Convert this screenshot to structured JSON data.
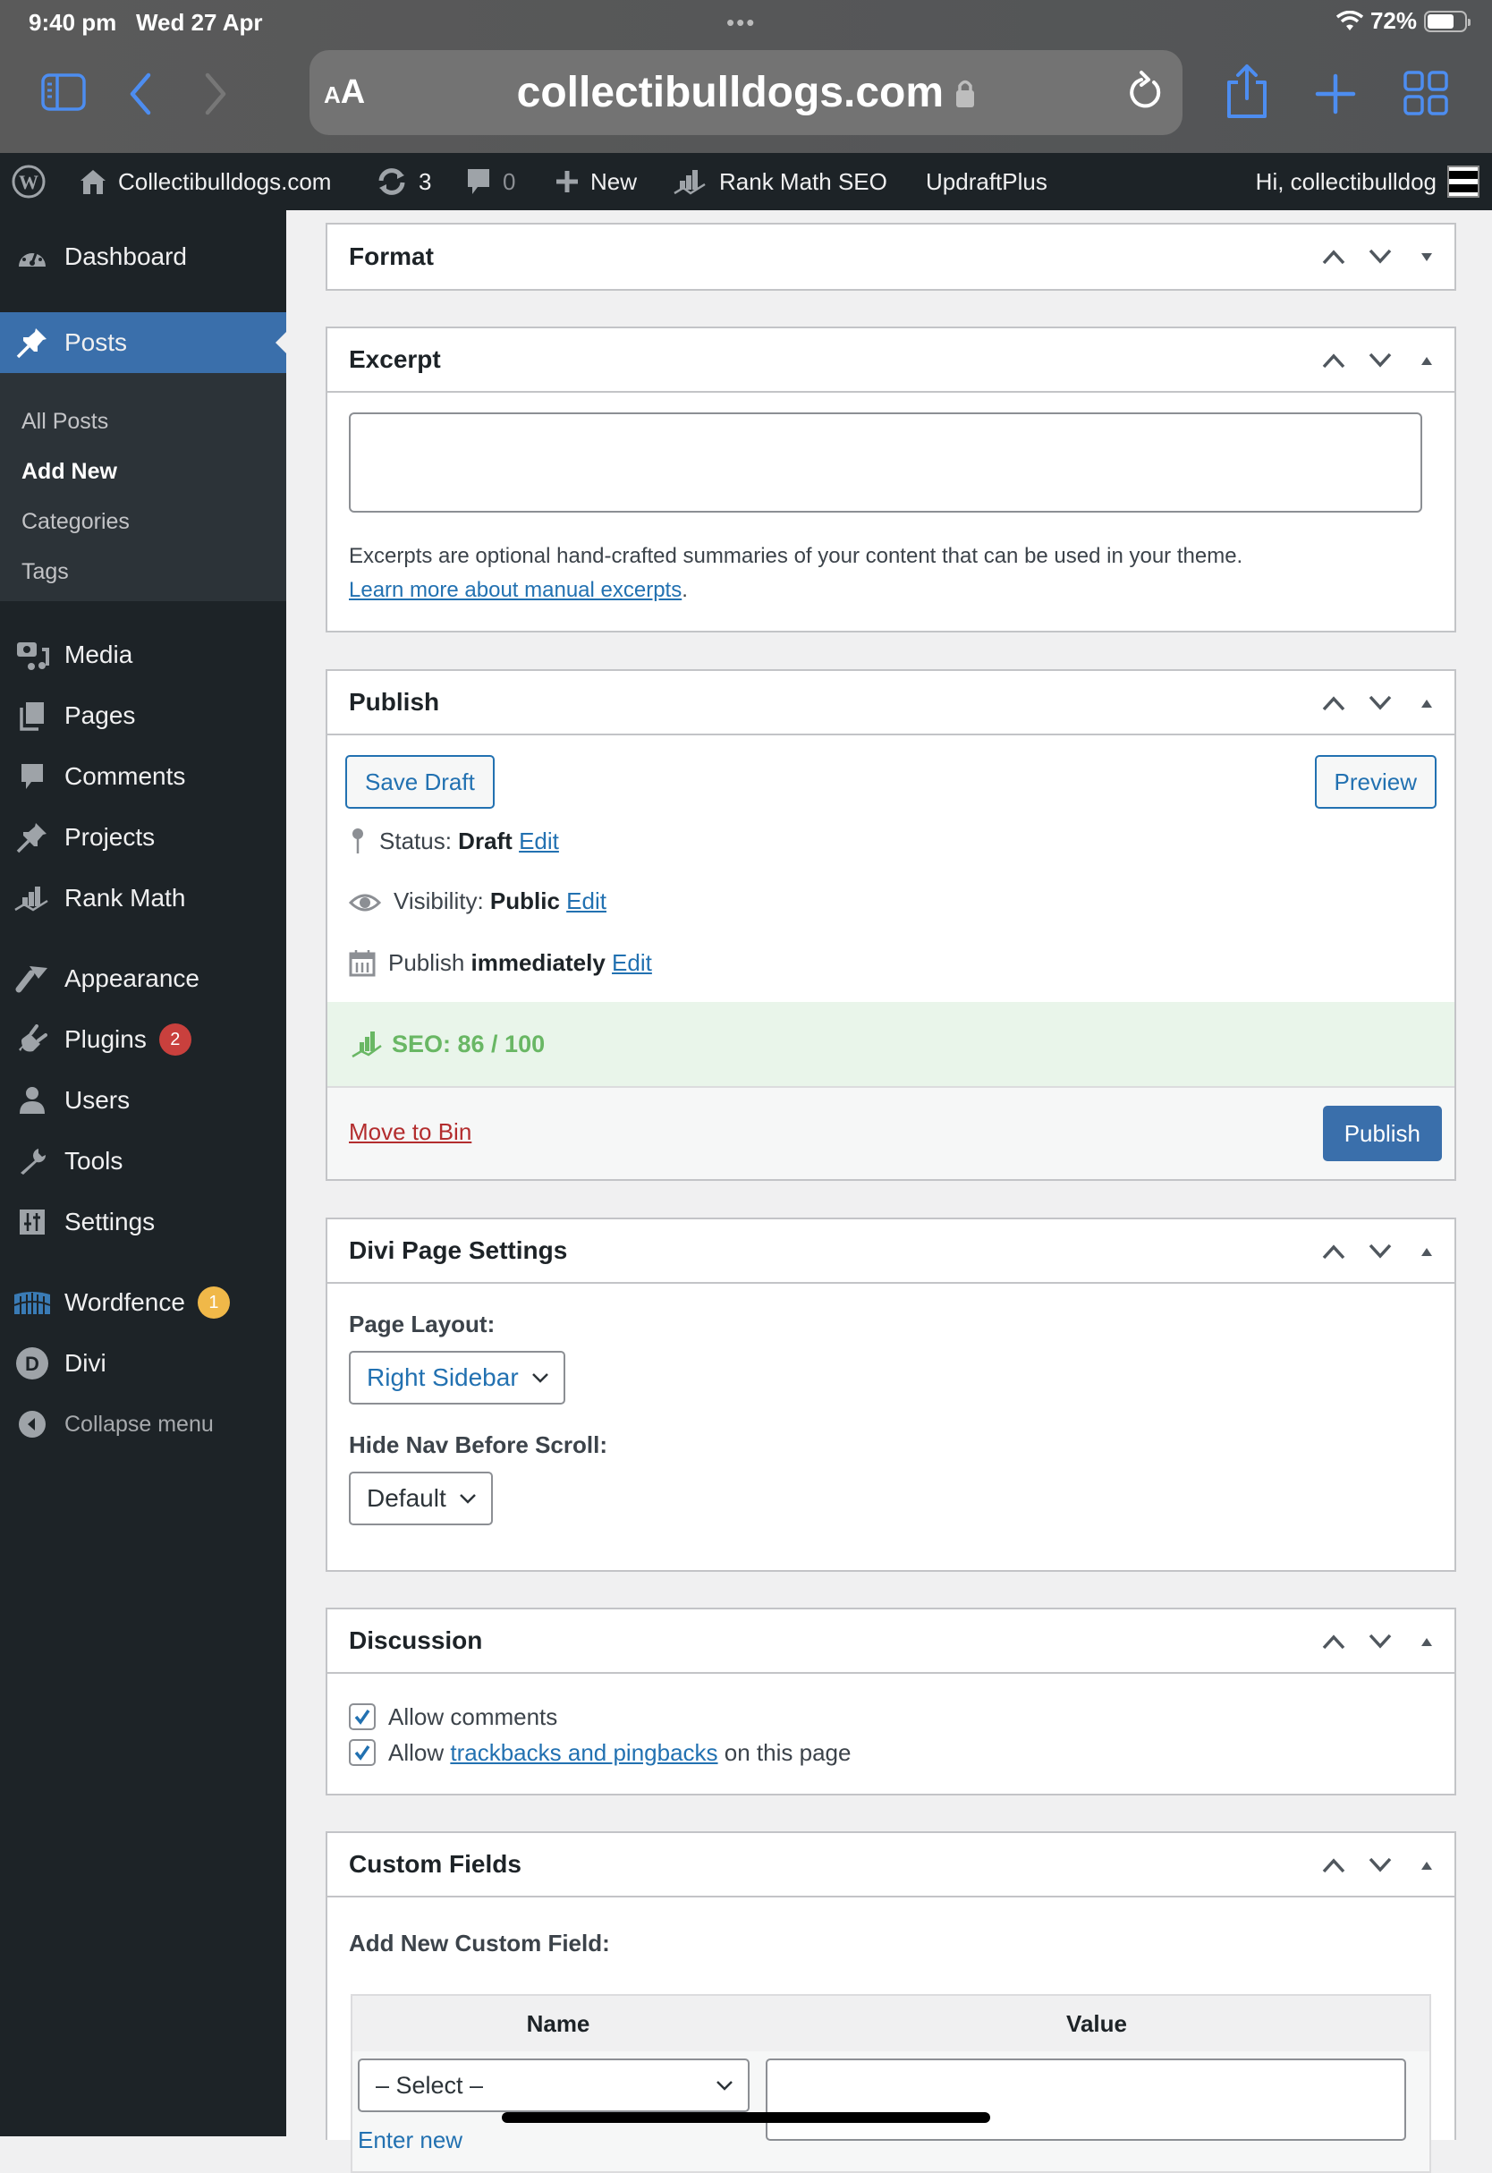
{
  "ios_status": {
    "time": "9:40 pm",
    "date": "Wed 27 Apr",
    "battery_percent": "72%",
    "battery_level": 0.72,
    "icons": [
      "wifi-icon",
      "battery-icon"
    ]
  },
  "safari": {
    "url": "collectibulldogs.com",
    "text_size_label_small": "A",
    "text_size_label_large": "A",
    "icons": [
      "sidebar-icon",
      "back-icon",
      "forward-icon",
      "lock-icon",
      "reload-icon",
      "share-icon",
      "new-tab-icon",
      "tabs-overview-icon"
    ]
  },
  "adminbar": {
    "site_name": "Collectibulldogs.com",
    "updates_count": "3",
    "comments_count": "0",
    "new_label": "New",
    "rankmath_label": "Rank Math SEO",
    "updraft_label": "UpdraftPlus",
    "greeting": "Hi, collectibulldog"
  },
  "sidebar": {
    "items": [
      {
        "label": "Dashboard",
        "icon": "dashboard-icon"
      },
      {
        "label": "Posts",
        "icon": "pin-icon",
        "active": true
      },
      {
        "label": "Media",
        "icon": "media-icon"
      },
      {
        "label": "Pages",
        "icon": "pages-icon"
      },
      {
        "label": "Comments",
        "icon": "comments-icon"
      },
      {
        "label": "Projects",
        "icon": "pin-icon"
      },
      {
        "label": "Rank Math",
        "icon": "rankmath-icon"
      },
      {
        "label": "Appearance",
        "icon": "paintbrush-icon"
      },
      {
        "label": "Plugins",
        "icon": "plugin-icon",
        "badge": "2"
      },
      {
        "label": "Users",
        "icon": "user-icon"
      },
      {
        "label": "Tools",
        "icon": "wrench-icon"
      },
      {
        "label": "Settings",
        "icon": "settings-icon"
      },
      {
        "label": "Wordfence",
        "icon": "wordfence-icon",
        "badge": "1"
      },
      {
        "label": "Divi",
        "icon": "divi-icon"
      },
      {
        "label": "Collapse menu",
        "icon": "collapse-icon"
      }
    ],
    "posts_submenu": [
      {
        "label": "All Posts"
      },
      {
        "label": "Add New",
        "current": true
      },
      {
        "label": "Categories"
      },
      {
        "label": "Tags"
      }
    ]
  },
  "boxes": {
    "format": {
      "title": "Format"
    },
    "excerpt": {
      "title": "Excerpt",
      "value": "",
      "help": "Excerpts are optional hand-crafted summaries of your content that can be used in your theme.",
      "link": "Learn more about manual excerpts",
      "link_suffix": "."
    },
    "publish": {
      "title": "Publish",
      "save_draft": "Save Draft",
      "preview": "Preview",
      "status_label": "Status:",
      "status_value": "Draft",
      "visibility_label": "Visibility:",
      "visibility_value": "Public",
      "schedule_label": "Publish",
      "schedule_value": "immediately",
      "edit": "Edit",
      "seo": "SEO: 86 / 100",
      "seo_score": 86,
      "seo_max": 100,
      "trash": "Move to Bin",
      "publish": "Publish"
    },
    "divi": {
      "title": "Divi Page Settings",
      "layout_label": "Page Layout:",
      "layout_value": "Right Sidebar",
      "hide_nav_label": "Hide Nav Before Scroll:",
      "hide_nav_value": "Default"
    },
    "discussion": {
      "title": "Discussion",
      "allow_comments": "Allow comments",
      "allow_comments_checked": true,
      "allow_pings_prefix": "Allow",
      "allow_pings_link": "trackbacks and pingbacks",
      "allow_pings_suffix": "on this page",
      "allow_pings_checked": true
    },
    "custom_fields": {
      "title": "Custom Fields",
      "add_new_label": "Add New Custom Field:",
      "col_name": "Name",
      "col_value": "Value",
      "name_select": "– Select –",
      "value": "",
      "enter_new": "Enter new"
    }
  },
  "colors": {
    "accent": "#2271b1",
    "admin_bg": "#1d2327",
    "seo_green": "#69b764",
    "danger": "#b32d2e",
    "badge_red": "#c9403d",
    "badge_yellow": "#f0b849"
  }
}
